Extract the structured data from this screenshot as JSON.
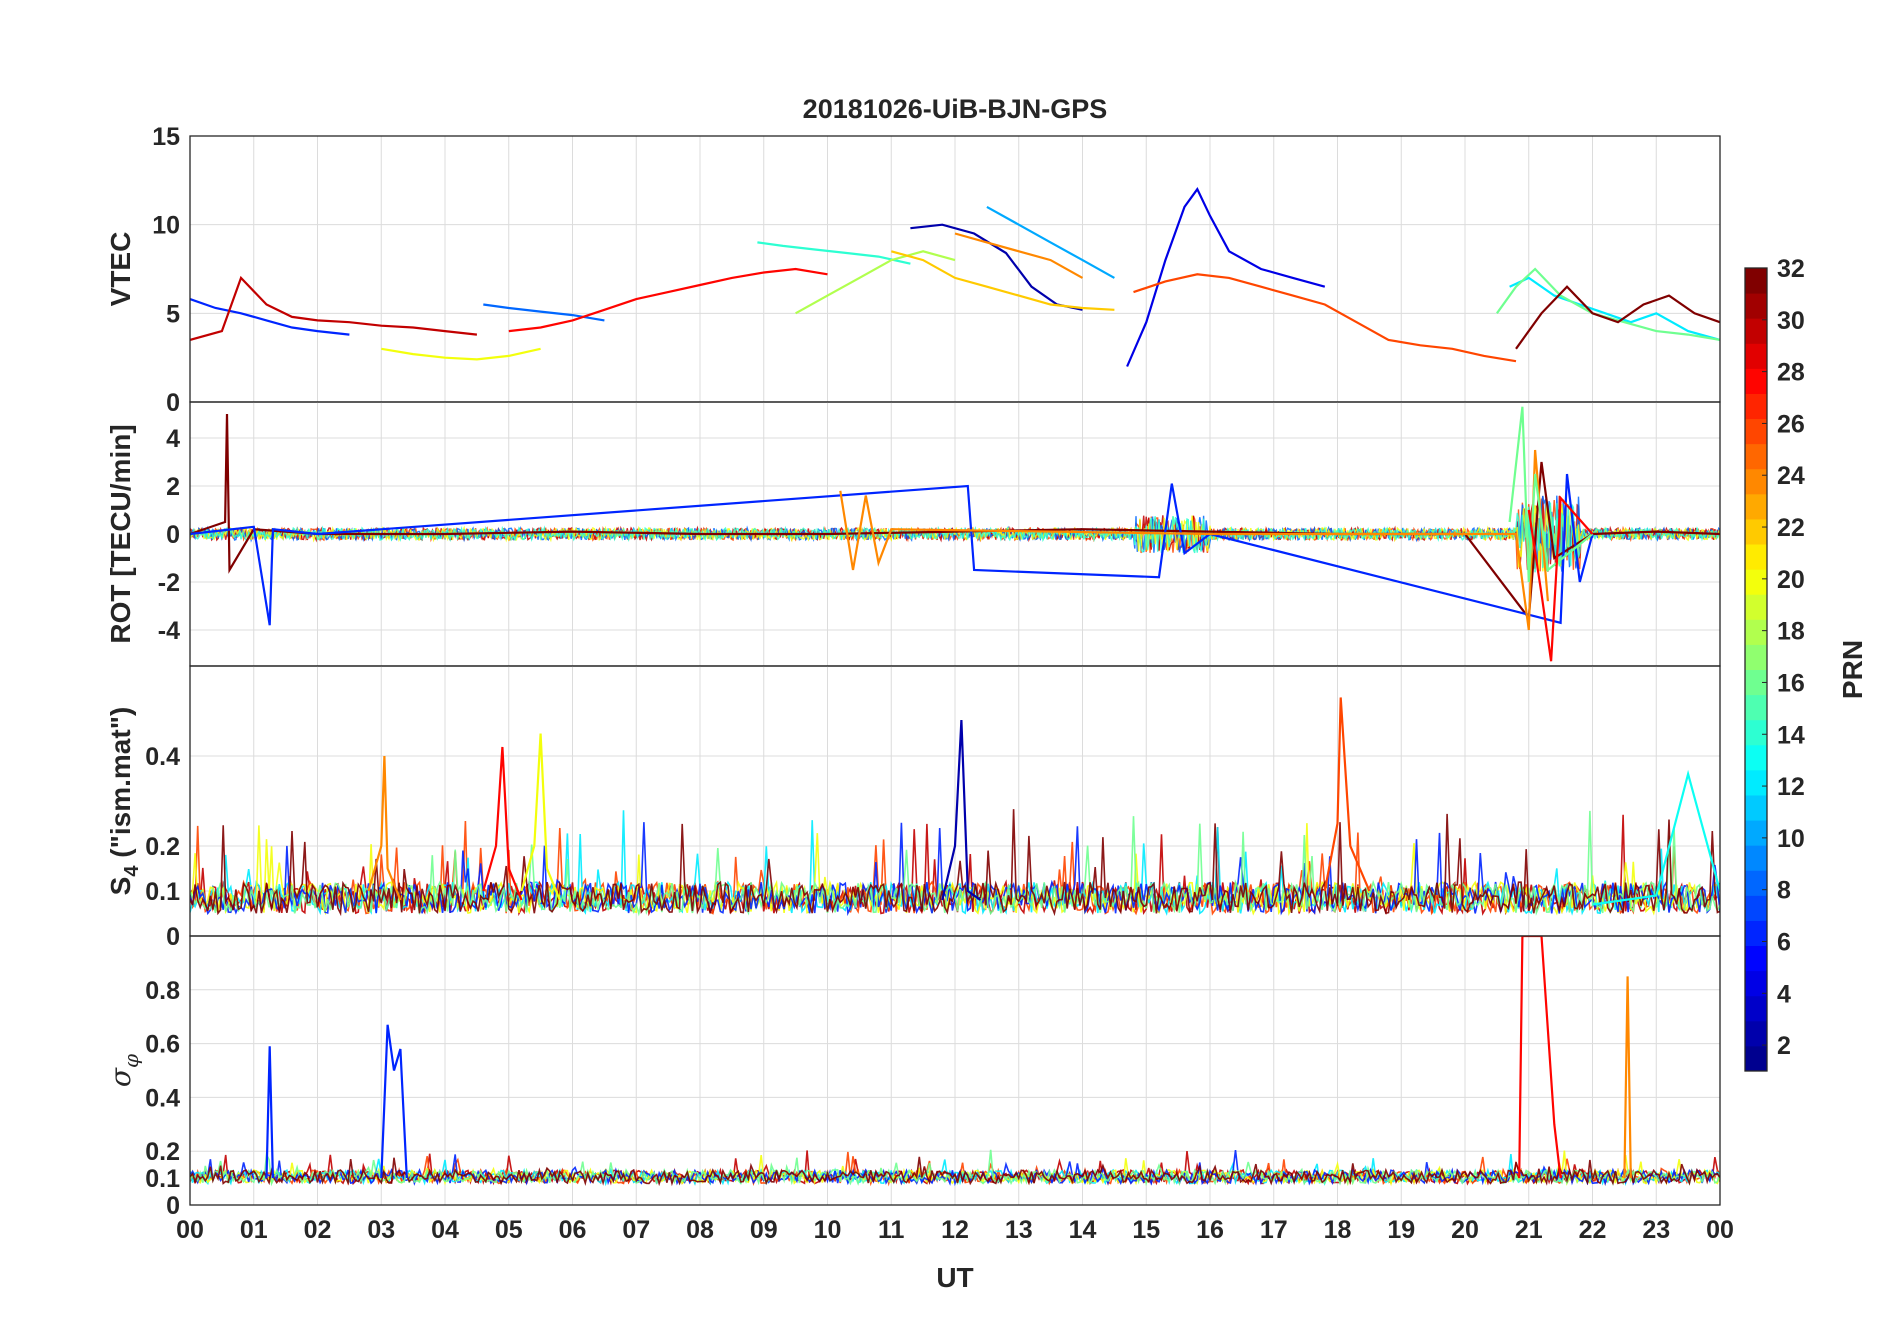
{
  "chart_data": {
    "type": "line",
    "title": "20181026-UiB-BJN-GPS",
    "xlabel": "UT",
    "x_ticks": [
      "00",
      "01",
      "02",
      "03",
      "04",
      "05",
      "06",
      "07",
      "08",
      "09",
      "10",
      "11",
      "12",
      "13",
      "14",
      "15",
      "16",
      "17",
      "18",
      "19",
      "20",
      "21",
      "22",
      "23",
      "00"
    ],
    "xlim": [
      0,
      24
    ],
    "grid": true,
    "colorbar": {
      "label": "PRN",
      "range": [
        1,
        32
      ],
      "ticks": [
        "2",
        "4",
        "6",
        "8",
        "10",
        "12",
        "14",
        "16",
        "18",
        "20",
        "22",
        "24",
        "26",
        "28",
        "30",
        "32"
      ],
      "colormap": "jet",
      "colors": [
        "#00008f",
        "#0000ff",
        "#0080ff",
        "#00ffff",
        "#80ff80",
        "#ffff00",
        "#ff8000",
        "#ff0000",
        "#800000"
      ]
    },
    "panels": [
      {
        "id": "vtec",
        "ylabel": "VTEC",
        "ylim": [
          0,
          15
        ],
        "y_ticks": [
          "0",
          "5",
          "10",
          "15"
        ],
        "series": [
          {
            "prn": 2,
            "x": [
              11.3,
              11.8,
              12.3,
              12.8,
              13.2,
              13.6,
              14.0
            ],
            "y": [
              9.8,
              10.0,
              9.5,
              8.4,
              6.5,
              5.5,
              5.2
            ]
          },
          {
            "prn": 4,
            "x": [
              14.7,
              15.0,
              15.3,
              15.6,
              15.8,
              16.0,
              16.3,
              16.8,
              17.3,
              17.8
            ],
            "y": [
              2.0,
              4.5,
              8.0,
              11.0,
              12.0,
              10.5,
              8.5,
              7.5,
              7.0,
              6.5
            ]
          },
          {
            "prn": 6,
            "x": [
              0.0,
              0.4,
              0.8,
              1.2,
              1.6,
              2.0,
              2.5
            ],
            "y": [
              5.8,
              5.3,
              5.0,
              4.6,
              4.2,
              4.0,
              3.8
            ]
          },
          {
            "prn": 8,
            "x": [
              4.6,
              5.0,
              5.5,
              6.0,
              6.5
            ],
            "y": [
              5.5,
              5.3,
              5.1,
              4.9,
              4.6
            ]
          },
          {
            "prn": 10,
            "x": [
              12.5,
              13.0,
              13.5,
              14.0,
              14.5
            ],
            "y": [
              11.0,
              10.0,
              9.0,
              8.0,
              7.0
            ]
          },
          {
            "prn": 12,
            "x": [
              20.7,
              21.0,
              21.4,
              21.8,
              22.2,
              22.6,
              23.0,
              23.5,
              24.0
            ],
            "y": [
              6.5,
              7.0,
              6.0,
              5.5,
              5.0,
              4.5,
              5.0,
              4.0,
              3.5
            ]
          },
          {
            "prn": 14,
            "x": [
              8.9,
              9.3,
              9.8,
              10.3,
              10.8,
              11.3
            ],
            "y": [
              9.0,
              8.8,
              8.6,
              8.4,
              8.2,
              7.8
            ]
          },
          {
            "prn": 16,
            "x": [
              20.5,
              20.8,
              21.1,
              21.5,
              22.0,
              22.5,
              23.0,
              23.5,
              24.0
            ],
            "y": [
              5.0,
              6.5,
              7.5,
              6.0,
              5.0,
              4.5,
              4.0,
              3.8,
              3.5
            ]
          },
          {
            "prn": 18,
            "x": [
              9.5,
              10.0,
              10.5,
              11.0,
              11.5,
              12.0
            ],
            "y": [
              5.0,
              6.0,
              7.0,
              8.0,
              8.5,
              8.0
            ]
          },
          {
            "prn": 20,
            "x": [
              3.0,
              3.5,
              4.0,
              4.5,
              5.0,
              5.5
            ],
            "y": [
              3.0,
              2.7,
              2.5,
              2.4,
              2.6,
              3.0
            ]
          },
          {
            "prn": 22,
            "x": [
              11.0,
              11.5,
              12.0,
              12.5,
              13.0,
              13.5,
              14.0,
              14.5
            ],
            "y": [
              8.5,
              8.0,
              7.0,
              6.5,
              6.0,
              5.5,
              5.3,
              5.2
            ]
          },
          {
            "prn": 24,
            "x": [
              12.0,
              12.5,
              13.0,
              13.5,
              14.0
            ],
            "y": [
              9.5,
              9.0,
              8.5,
              8.0,
              7.0
            ]
          },
          {
            "prn": 26,
            "x": [
              14.8,
              15.3,
              15.8,
              16.3,
              16.8,
              17.3,
              17.8,
              18.3,
              18.8,
              19.3,
              19.8,
              20.3,
              20.8
            ],
            "y": [
              6.2,
              6.8,
              7.2,
              7.0,
              6.5,
              6.0,
              5.5,
              4.5,
              3.5,
              3.2,
              3.0,
              2.6,
              2.3
            ]
          },
          {
            "prn": 28,
            "x": [
              5.0,
              5.5,
              6.0,
              6.5,
              7.0,
              7.5,
              8.0,
              8.5,
              9.0,
              9.5,
              10.0
            ],
            "y": [
              4.0,
              4.2,
              4.6,
              5.2,
              5.8,
              6.2,
              6.6,
              7.0,
              7.3,
              7.5,
              7.2
            ]
          },
          {
            "prn": 30,
            "x": [
              0.0,
              0.5,
              0.8,
              1.2,
              1.6,
              2.0,
              2.5,
              3.0,
              3.5,
              4.0,
              4.5
            ],
            "y": [
              3.5,
              4.0,
              7.0,
              5.5,
              4.8,
              4.6,
              4.5,
              4.3,
              4.2,
              4.0,
              3.8
            ]
          },
          {
            "prn": 32,
            "x": [
              20.8,
              21.2,
              21.6,
              22.0,
              22.4,
              22.8,
              23.2,
              23.6,
              24.0
            ],
            "y": [
              3.0,
              5.0,
              6.5,
              5.0,
              4.5,
              5.5,
              6.0,
              5.0,
              4.5
            ]
          }
        ]
      },
      {
        "id": "rot",
        "ylabel": "ROT [TECU/min]",
        "ylim": [
          -5.5,
          5.5
        ],
        "y_ticks": [
          "-4",
          "-2",
          "0",
          "2",
          "4"
        ],
        "series": [
          {
            "prn": 32,
            "x": [
              0.0,
              0.55,
              0.58,
              0.62,
              1.0,
              2.0,
              4.0,
              6.0,
              8.0,
              10.0,
              12.0,
              14.0,
              16.0,
              18.0,
              20.0,
              21.0,
              21.2,
              21.4,
              22.0,
              23.0,
              24.0
            ],
            "y": [
              0.0,
              0.5,
              5.0,
              -1.5,
              0.2,
              0.0,
              0.0,
              0.1,
              0.0,
              0.0,
              0.1,
              0.2,
              0.1,
              0.0,
              0.0,
              -3.5,
              3.0,
              -1.0,
              0.0,
              0.1,
              0.0
            ]
          },
          {
            "prn": 6,
            "x": [
              0.0,
              1.0,
              1.25,
              1.3,
              2.0,
              12.2,
              12.3,
              15.2,
              15.4,
              15.6,
              16.0,
              21.5,
              21.6,
              21.8,
              22.0
            ],
            "y": [
              0.0,
              0.3,
              -3.8,
              0.2,
              0.0,
              2.0,
              -1.5,
              -1.8,
              2.1,
              -0.8,
              0.0,
              -3.7,
              2.5,
              -2.0,
              0.0
            ]
          },
          {
            "prn": 24,
            "x": [
              10.2,
              10.4,
              10.6,
              10.8,
              11.0,
              16.0,
              20.8,
              21.0,
              21.1,
              21.3
            ],
            "y": [
              1.8,
              -1.5,
              1.6,
              -1.2,
              0.2,
              0.0,
              0.0,
              -4.0,
              3.5,
              -2.8
            ]
          },
          {
            "prn": 16,
            "x": [
              20.7,
              20.9,
              21.0,
              21.1,
              21.3,
              22.0
            ],
            "y": [
              0.5,
              5.3,
              -2.0,
              2.5,
              -1.5,
              0.0
            ]
          },
          {
            "prn": 28,
            "x": [
              21.0,
              21.2,
              21.35,
              21.5,
              22.0
            ],
            "y": [
              1.0,
              -2.5,
              -5.3,
              1.5,
              0.0
            ]
          }
        ]
      },
      {
        "id": "s4",
        "ylabel": "S4 (\"ism.mat\")",
        "ylabel_main": "S",
        "ylabel_sub": "4",
        "ylabel_rest": " (\"ism.mat\")",
        "ylim": [
          0,
          0.6
        ],
        "y_ticks": [
          "0",
          "0.1",
          "0.2",
          "0.4"
        ],
        "series": [
          {
            "prn": 2,
            "x": [
              11.8,
              12.0,
              12.1,
              12.2,
              12.4
            ],
            "y": [
              0.08,
              0.2,
              0.48,
              0.1,
              0.08
            ]
          },
          {
            "prn": 26,
            "x": [
              17.8,
              18.0,
              18.05,
              18.2,
              18.5
            ],
            "y": [
              0.1,
              0.25,
              0.53,
              0.2,
              0.1
            ]
          },
          {
            "prn": 28,
            "x": [
              4.6,
              4.8,
              4.9,
              5.0,
              5.2
            ],
            "y": [
              0.1,
              0.2,
              0.42,
              0.15,
              0.08
            ]
          },
          {
            "prn": 20,
            "x": [
              5.2,
              5.4,
              5.5,
              5.6,
              5.8
            ],
            "y": [
              0.1,
              0.2,
              0.45,
              0.15,
              0.08
            ]
          },
          {
            "prn": 24,
            "x": [
              2.8,
              3.0,
              3.05,
              3.1,
              3.3
            ],
            "y": [
              0.1,
              0.2,
              0.4,
              0.15,
              0.08
            ]
          },
          {
            "prn": 13,
            "x": [
              22.0,
              23.0,
              23.5,
              24.0
            ],
            "y": [
              0.07,
              0.09,
              0.36,
              0.1
            ]
          }
        ],
        "baseline": [
          0.05,
          0.12
        ]
      },
      {
        "id": "sigma_phi",
        "ylabel": "σφ",
        "ylim": [
          0,
          1
        ],
        "y_ticks": [
          "0",
          "0.1",
          "0.2",
          "0.4",
          "0.6",
          "0.8"
        ],
        "series": [
          {
            "prn": 6,
            "x": [
              1.2,
              1.25,
              1.3
            ],
            "y": [
              0.1,
              0.59,
              0.1
            ]
          },
          {
            "prn": 6,
            "x": [
              3.0,
              3.1,
              3.2,
              3.3,
              3.4
            ],
            "y": [
              0.1,
              0.67,
              0.5,
              0.58,
              0.1
            ]
          },
          {
            "prn": 24,
            "x": [
              22.5,
              22.55,
              22.6
            ],
            "y": [
              0.1,
              0.85,
              0.1
            ]
          },
          {
            "prn": 28,
            "x": [
              20.85,
              20.9,
              21.1,
              21.2,
              21.4,
              21.5
            ],
            "y": [
              0.1,
              1.0,
              1.0,
              1.0,
              0.3,
              0.1
            ]
          }
        ],
        "baseline": [
          0.08,
          0.13
        ]
      }
    ]
  }
}
